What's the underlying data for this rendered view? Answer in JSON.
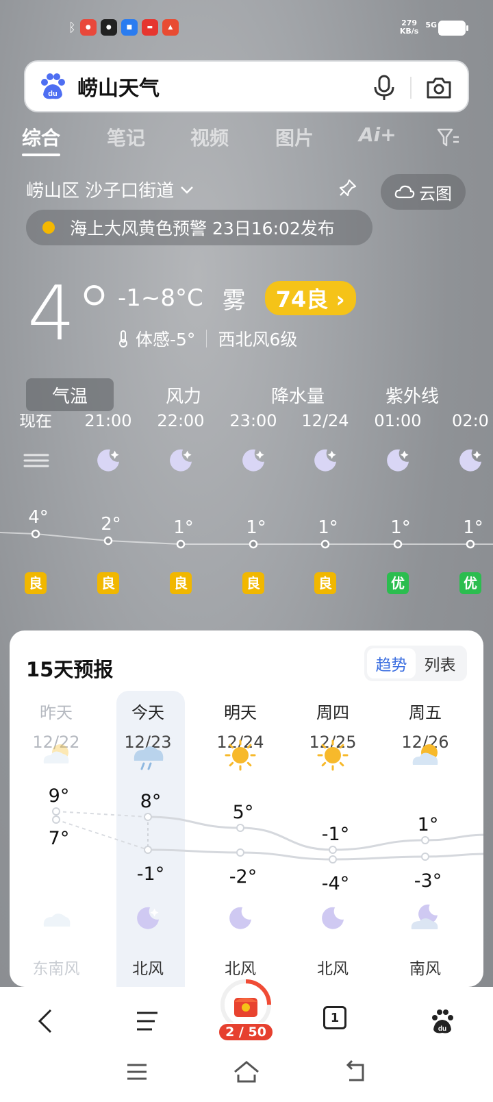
{
  "status_bar": {
    "speed_value": "279",
    "speed_unit": "KB/s",
    "network": "5G"
  },
  "search": {
    "query": "崂山天气"
  },
  "tabs": [
    {
      "label": "综合",
      "active": true
    },
    {
      "label": "笔记"
    },
    {
      "label": "视频"
    },
    {
      "label": "图片"
    },
    {
      "label": "Ai+"
    }
  ],
  "location": {
    "name": "崂山区 沙子口街道"
  },
  "cloud_button": {
    "label": "云图"
  },
  "alert": {
    "text": "海上大风黄色预警 23日16:02发布",
    "color": "#f5b800"
  },
  "current": {
    "temp": "4°",
    "range": "-1~8°C",
    "condition": "雾",
    "aqi": "74良 ›",
    "feels": "体感-5°",
    "wind": "西北风6级"
  },
  "metric_tabs": [
    "气温",
    "风力",
    "降水量",
    "紫外线"
  ],
  "hourly": [
    {
      "time": "现在",
      "temp": "4°",
      "quality": "良",
      "temp_value": 4
    },
    {
      "time": "21:00",
      "temp": "2°",
      "quality": "良",
      "temp_value": 2
    },
    {
      "time": "22:00",
      "temp": "1°",
      "quality": "良",
      "temp_value": 1
    },
    {
      "time": "23:00",
      "temp": "1°",
      "quality": "良",
      "temp_value": 1
    },
    {
      "time": "12/24",
      "temp": "1°",
      "quality": "良",
      "temp_value": 1
    },
    {
      "time": "01:00",
      "temp": "1°",
      "quality": "优",
      "temp_value": 1
    },
    {
      "time": "02:0",
      "temp": "1°",
      "quality": "优",
      "temp_value": 1
    }
  ],
  "forecast": {
    "title": "15天预报",
    "toggle": [
      "趋势",
      "列表"
    ],
    "days": [
      {
        "name": "昨天",
        "date": "12/22",
        "high": "9°",
        "low": "7°",
        "wind": "东南风",
        "high_value": 9,
        "low_value": 7
      },
      {
        "name": "今天",
        "date": "12/23",
        "high": "8°",
        "low": "-1°",
        "wind": "北风",
        "high_value": 8,
        "low_value": -1
      },
      {
        "name": "明天",
        "date": "12/24",
        "high": "5°",
        "low": "-2°",
        "wind": "北风",
        "high_value": 5,
        "low_value": -2
      },
      {
        "name": "周四",
        "date": "12/25",
        "high": "-1°",
        "low": "-4°",
        "wind": "北风",
        "high_value": -1,
        "low_value": -4
      },
      {
        "name": "周五",
        "date": "12/26",
        "high": "1°",
        "low": "-3°",
        "wind": "南风",
        "high_value": 1,
        "low_value": -3
      }
    ]
  },
  "bottom_nav": {
    "badge": "2 / 50",
    "tab_count": "1"
  }
}
